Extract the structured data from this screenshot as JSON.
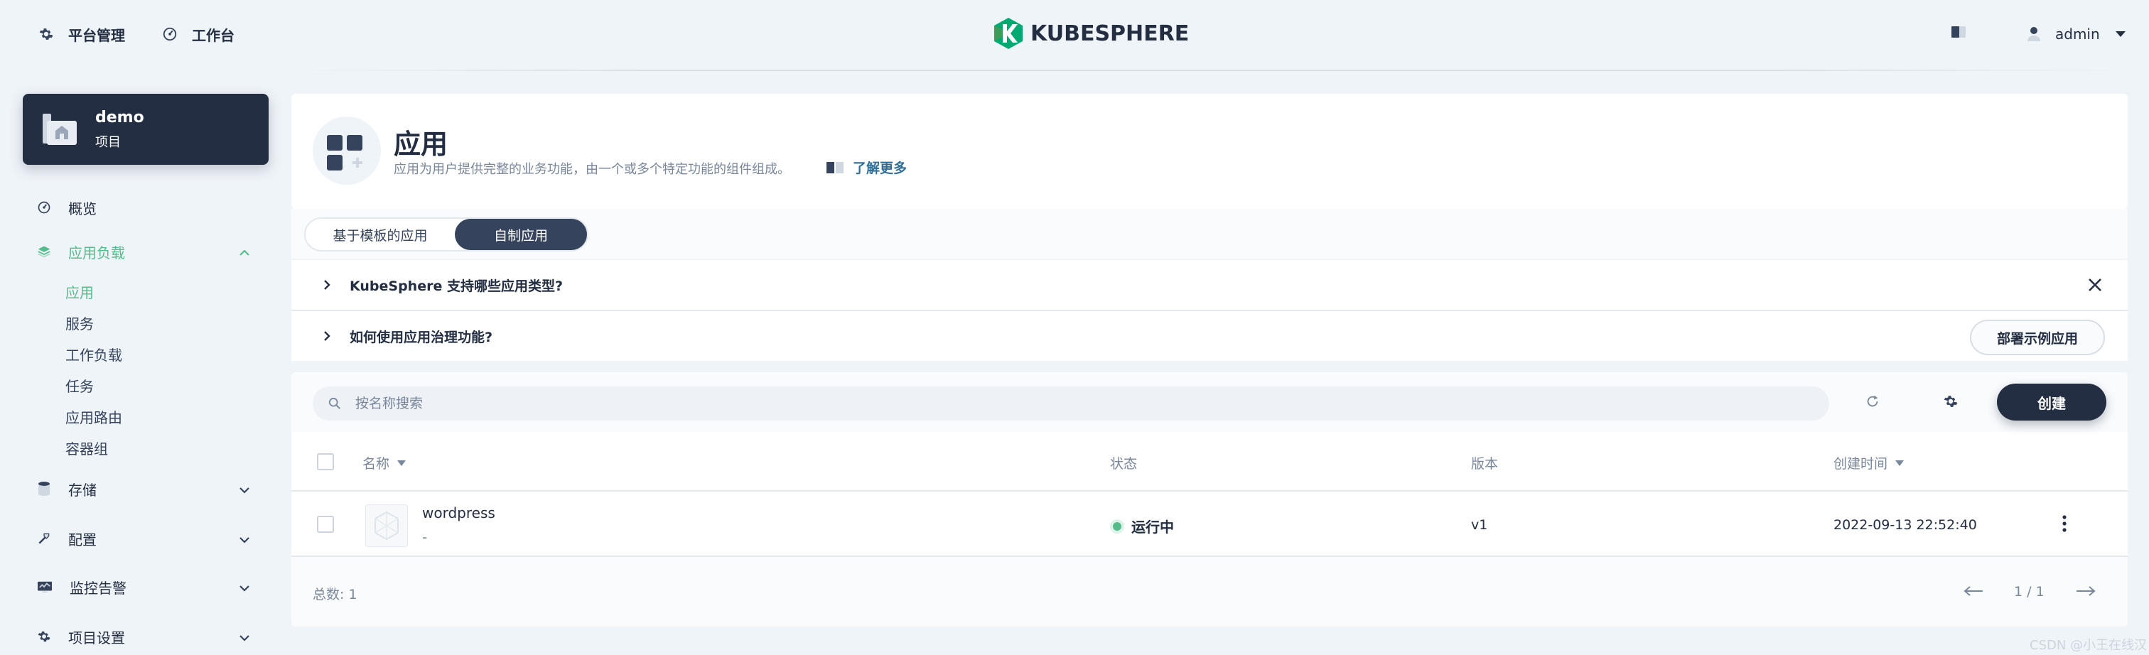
{
  "topbar": {
    "platform_label": "平台管理",
    "workbench_label": "工作台",
    "logo_text": "KUBESPHERE",
    "user_name": "admin"
  },
  "sidebar": {
    "project_name": "demo",
    "project_type": "项目",
    "overview": "概览",
    "app_workloads": "应用负载",
    "sub_items": [
      "应用",
      "服务",
      "工作负载",
      "任务",
      "应用路由",
      "容器组"
    ],
    "storage": "存储",
    "config": "配置",
    "monitoring": "监控告警",
    "project_settings": "项目设置"
  },
  "header": {
    "title": "应用",
    "description": "应用为用户提供完整的业务功能，由一个或多个特定功能的组件组成。",
    "learn_more": "了解更多"
  },
  "tabs": {
    "template_apps": "基于模板的应用",
    "custom_apps": "自制应用",
    "active": "custom_apps"
  },
  "faq": {
    "q1": "KubeSphere 支持哪些应用类型?",
    "q2": "如何使用应用治理功能?",
    "deploy_sample": "部署示例应用"
  },
  "toolbar": {
    "search_placeholder": "按名称搜索",
    "create_label": "创建"
  },
  "table": {
    "columns": [
      "名称",
      "状态",
      "版本",
      "创建时间"
    ],
    "rows": [
      {
        "name": "wordpress",
        "description": "-",
        "status": "运行中",
        "version": "v1",
        "created": "2022-09-13 22:52:40"
      }
    ]
  },
  "footer": {
    "total": "总数:  1",
    "page": "1 / 1"
  },
  "watermark": "CSDN @小王在线汉化",
  "colors": {
    "accent": "#55bc8a",
    "dark": "#242e42",
    "link": "#326e93",
    "background": "#eff4f9"
  }
}
